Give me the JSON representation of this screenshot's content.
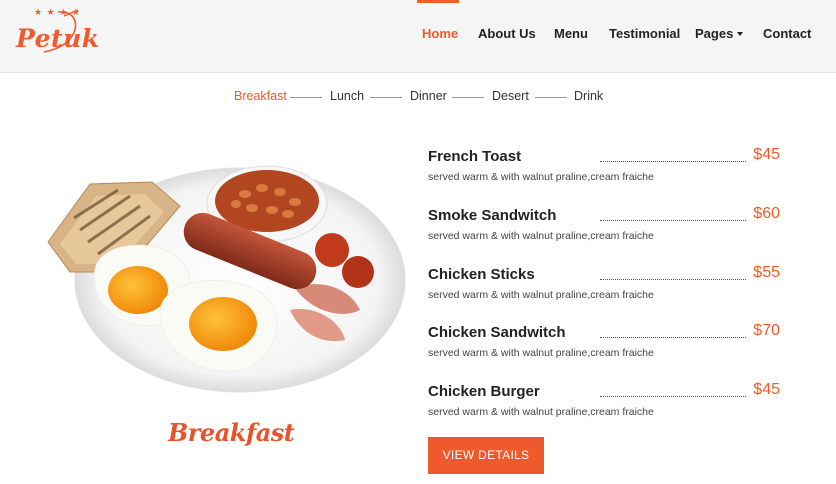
{
  "brand": {
    "name": "Petuk",
    "stars": "★ ★ ★ ★",
    "accent": "#f15a2b"
  },
  "nav": {
    "items": [
      {
        "label": "Home",
        "active": true
      },
      {
        "label": "About Us"
      },
      {
        "label": "Menu"
      },
      {
        "label": "Testimonial"
      },
      {
        "label": "Pages",
        "dropdown": true
      },
      {
        "label": "Contact"
      }
    ]
  },
  "tabs": [
    {
      "label": "Breakfast",
      "active": true
    },
    {
      "label": "Lunch"
    },
    {
      "label": "Dinner"
    },
    {
      "label": "Desert"
    },
    {
      "label": "Drink"
    }
  ],
  "feature": {
    "caption": "Breakfast"
  },
  "menu": {
    "items": [
      {
        "name": "French Toast",
        "price": "$45",
        "desc": "served warm & with walnut praline,cream fraiche"
      },
      {
        "name": "Smoke Sandwitch",
        "price": "$60",
        "desc": "served warm & with walnut praline,cream fraiche"
      },
      {
        "name": "Chicken Sticks",
        "price": "$55",
        "desc": "served warm & with walnut praline,cream fraiche"
      },
      {
        "name": "Chicken Sandwitch",
        "price": "$70",
        "desc": "served warm & with walnut praline,cream fraiche"
      },
      {
        "name": "Chicken Burger",
        "price": "$45",
        "desc": "served warm & with walnut praline,cream fraiche"
      }
    ],
    "button": "VIEW DETAILS"
  }
}
